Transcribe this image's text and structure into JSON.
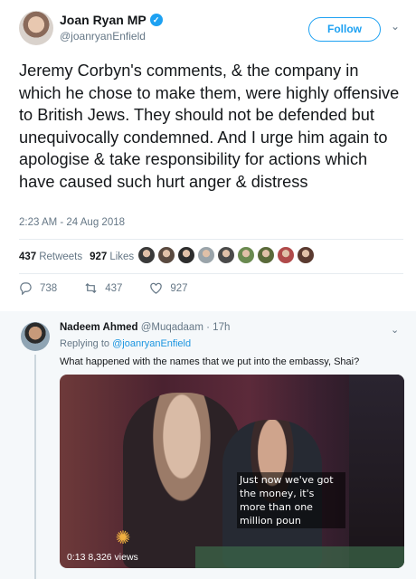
{
  "tweet": {
    "author_name": "Joan Ryan MP",
    "verified_mark": "✓",
    "handle": "@joanryanEnfield",
    "follow_label": "Follow",
    "menu_caret": "⌄",
    "text": "Jeremy Corbyn's comments, & the company in which he chose to make them, were highly offensive to British Jews. They should not be defended but unequivocally condemned. And I urge him again to apologise & take responsibility for actions which have caused such hurt anger & distress",
    "timestamp": "2:23 AM - 24 Aug 2018",
    "retweets_count": "437",
    "retweets_label": "Retweets",
    "likes_count": "927",
    "likes_label": "Likes",
    "liker_avatar_colors": [
      "#3a3a3a",
      "#5a4a40",
      "#2d2d2d",
      "#9aa4aa",
      "#4a4a4a",
      "#6a8a50",
      "#5a6a3a",
      "#b04a4a",
      "#5a3a30"
    ],
    "actions": {
      "reply_count": "738",
      "retweet_count": "437",
      "like_count": "927"
    }
  },
  "reply": {
    "author_name": "Nadeem Ahmed",
    "handle": "@Muqadaam",
    "separator": "·",
    "age": "17h",
    "menu_caret": "⌄",
    "replying_prefix": "Replying to",
    "replying_handle": "@joanryanEnfield",
    "text": "What happened with the names that we put into the embassy, Shai?",
    "video": {
      "caption": "Just now we've got the money, it's more than one million poun",
      "logo_glyph": "✺",
      "elapsed": "0:13",
      "views": "8,326 views"
    }
  },
  "colors": {
    "accent": "#1da1f2",
    "secondary_text": "#657786",
    "reply_background": "#f5f8fa"
  }
}
